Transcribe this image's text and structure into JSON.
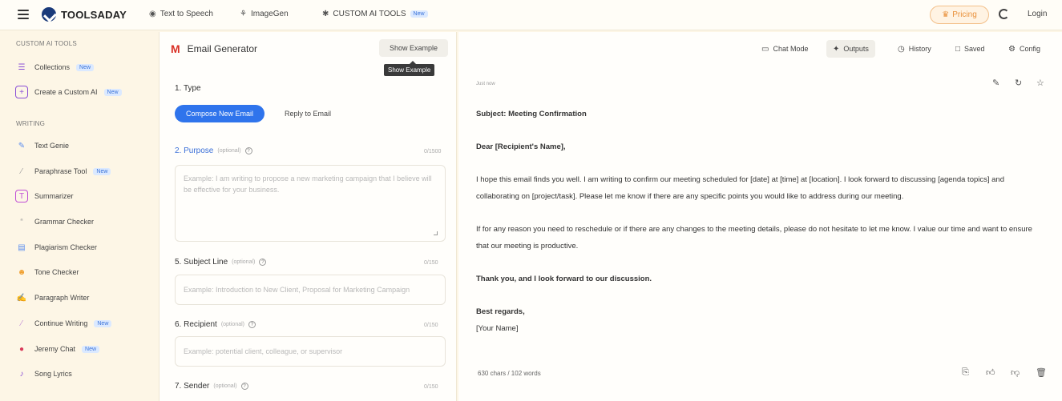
{
  "topbar": {
    "logo": "TOOLSADAY",
    "nav": [
      {
        "label": "Text to Speech",
        "icon": "speaker-icon"
      },
      {
        "label": "ImageGen",
        "icon": "image-icon"
      },
      {
        "label": "CUSTOM AI TOOLS",
        "icon": "tools-icon",
        "badge": "New"
      }
    ],
    "pricing": "Pricing",
    "login": "Login"
  },
  "sidebar": {
    "section_custom": "CUSTOM AI TOOLS",
    "custom_items": [
      {
        "label": "Collections",
        "badge": "New",
        "icon": "collections-icon",
        "color": "#8a4fd6"
      },
      {
        "label": "Create a Custom AI",
        "badge": "New",
        "icon": "plus-icon",
        "color": "#8a4fd6"
      }
    ],
    "section_writing": "WRITING",
    "writing_items": [
      {
        "label": "Text Genie",
        "icon": "genie-icon",
        "color": "#5b8def"
      },
      {
        "label": "Paraphrase Tool",
        "badge": "New",
        "icon": "paraphrase-icon",
        "color": "#9c9c9c"
      },
      {
        "label": "Summarizer",
        "icon": "summarizer-icon",
        "color": "#c04fd6"
      },
      {
        "label": "Grammar Checker",
        "icon": "grammar-icon",
        "color": "#9c9c9c"
      },
      {
        "label": "Plagiarism Checker",
        "icon": "plagiarism-icon",
        "color": "#5b8def"
      },
      {
        "label": "Tone Checker",
        "icon": "tone-icon",
        "color": "#f0a030"
      },
      {
        "label": "Paragraph Writer",
        "icon": "paragraph-icon",
        "color": "#5b8def"
      },
      {
        "label": "Continue Writing",
        "badge": "New",
        "icon": "continue-icon",
        "color": "#c08ad6"
      },
      {
        "label": "Jeremy Chat",
        "badge": "New",
        "icon": "chat-icon",
        "color": "#d93a5a"
      },
      {
        "label": "Song Lyrics",
        "icon": "music-icon",
        "color": "#8a4fd6"
      }
    ]
  },
  "generator": {
    "title": "Email Generator",
    "show_example": "Show Example",
    "tooltip": "Show Example",
    "type_label": "1. Type",
    "type_active": "Compose New Email",
    "type_other": "Reply to Email",
    "purpose_label": "2. Purpose",
    "purpose_optional": "(optional)",
    "purpose_counter": "0/1500",
    "purpose_placeholder": "Example: I am writing to propose a new marketing campaign that I believe will be effective for your business.",
    "subject_label": "5. Subject Line",
    "subject_optional": "(optional)",
    "subject_counter": "0/150",
    "subject_placeholder": "Example: Introduction to New Client, Proposal for Marketing Campaign",
    "recipient_label": "6. Recipient",
    "recipient_optional": "(optional)",
    "recipient_counter": "0/150",
    "recipient_placeholder": "Example: potential client, colleague, or supervisor",
    "sender_label": "7. Sender",
    "sender_optional": "(optional)",
    "sender_counter": "0/150"
  },
  "output_panel": {
    "tools": [
      "Chat Mode",
      "Outputs",
      "History",
      "Saved",
      "Config"
    ],
    "time": "Just now",
    "subject": "Subject: Meeting Confirmation",
    "greeting": "Dear [Recipient's Name],",
    "para1": "I hope this email finds you well. I am writing to confirm our meeting scheduled for [date] at [time] at [location]. I look forward to discussing [agenda topics] and collaborating on [project/task]. Please let me know if there are any specific points you would like to address during our meeting.",
    "para2": "If for any reason you need to reschedule or if there are any changes to the meeting details, please do not hesitate to let me know. I value our time and want to ensure that our meeting is productive.",
    "thanks": "Thank you, and I look forward to our discussion.",
    "closing": "Best regards,",
    "name": "[Your Name]",
    "counts": "630 chars / 102 words"
  },
  "colors": {
    "accent": "#2f74ec",
    "background": "#fdf6e6",
    "pricing": "#e9913b"
  }
}
